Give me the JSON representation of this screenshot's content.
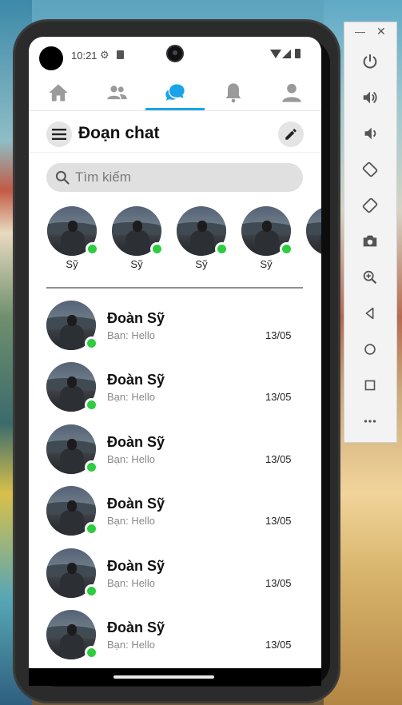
{
  "status_bar": {
    "time": "10:21"
  },
  "tabs": [
    {
      "id": "home",
      "icon": "home-icon",
      "active": false
    },
    {
      "id": "friends",
      "icon": "friends-icon",
      "active": false
    },
    {
      "id": "messages",
      "icon": "chat-bubbles-icon",
      "active": true
    },
    {
      "id": "notifications",
      "icon": "bell-icon",
      "active": false
    },
    {
      "id": "profile",
      "icon": "user-icon",
      "active": false
    }
  ],
  "header": {
    "title": "Đoạn chat",
    "menu_icon": "menu-icon",
    "edit_icon": "pencil-icon"
  },
  "search": {
    "placeholder": "Tìm kiếm"
  },
  "stories": [
    {
      "name": "Sỹ",
      "online": true
    },
    {
      "name": "Sỹ",
      "online": true
    },
    {
      "name": "Sỹ",
      "online": true
    },
    {
      "name": "Sỹ",
      "online": true
    },
    {
      "name": "",
      "online": false
    }
  ],
  "chats": [
    {
      "name": "Đoàn Sỹ",
      "preview": "Bạn: Hello",
      "date": "13/05",
      "online": true
    },
    {
      "name": "Đoàn Sỹ",
      "preview": "Bạn: Hello",
      "date": "13/05",
      "online": true
    },
    {
      "name": "Đoàn Sỹ",
      "preview": "Bạn: Hello",
      "date": "13/05",
      "online": true
    },
    {
      "name": "Đoàn Sỹ",
      "preview": "Bạn: Hello",
      "date": "13/05",
      "online": true
    },
    {
      "name": "Đoàn Sỹ",
      "preview": "Bạn: Hello",
      "date": "13/05",
      "online": true
    },
    {
      "name": "Đoàn Sỹ",
      "preview": "Bạn: Hello",
      "date": "13/05",
      "online": true
    }
  ],
  "colors": {
    "accent": "#1aa3e8",
    "online": "#2ecc40",
    "icon_inactive": "#9a9a9a"
  },
  "emulator_panel": {
    "buttons": [
      "power-icon",
      "volume-up-icon",
      "volume-down-icon",
      "rotate-left-icon",
      "rotate-right-icon",
      "camera-icon",
      "zoom-icon",
      "back-icon",
      "home-circle-icon",
      "overview-icon",
      "more-icon"
    ]
  }
}
